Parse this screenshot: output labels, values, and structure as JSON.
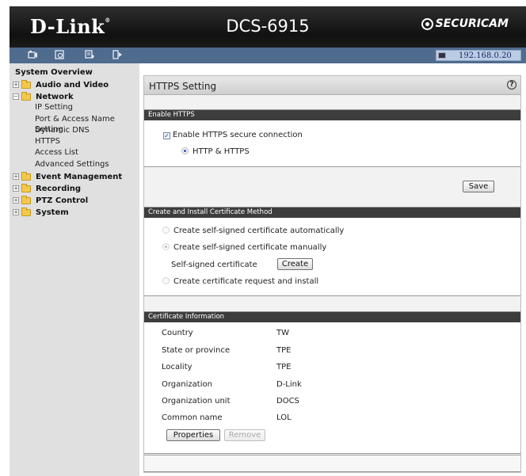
{
  "header": {
    "brand_logo": "D-Link",
    "registered_mark": "®",
    "model": "DCS-6915",
    "product_line": "SECURICAM"
  },
  "toolbar": {
    "icons": [
      "live-video-icon",
      "playback-icon",
      "setup-icon",
      "logout-icon"
    ],
    "ip_address": "192.168.0.20"
  },
  "sidebar": {
    "title": "System Overview",
    "groups": [
      {
        "label": "Audio and Video",
        "expanded": false
      },
      {
        "label": "Network",
        "expanded": true,
        "items": [
          "IP Setting",
          "Port & Access Name Setting",
          "Dynamic DNS",
          "HTTPS",
          "Access List",
          "Advanced Settings"
        ]
      },
      {
        "label": "Event Management",
        "expanded": false
      },
      {
        "label": "Recording",
        "expanded": false
      },
      {
        "label": "PTZ Control",
        "expanded": false
      },
      {
        "label": "System",
        "expanded": false
      }
    ]
  },
  "page": {
    "title": "HTTPS Setting",
    "help_glyph": "?"
  },
  "enable_section": {
    "header": "Enable HTTPS",
    "checkbox_label": "Enable HTTPS secure connection",
    "checkbox_checked": true,
    "mode_label": "HTTP & HTTPS",
    "save_label": "Save"
  },
  "cert_method": {
    "header": "Create and Install Certificate Method",
    "option_auto": "Create self-signed certificate automatically",
    "option_manual": "Create self-signed certificate manually",
    "self_signed_label": "Self-signed certificate",
    "create_label": "Create",
    "option_request": "Create certificate request and install",
    "selected": "manual"
  },
  "cert_info": {
    "header": "Certificate Information",
    "rows": [
      {
        "label": "Country",
        "value": "TW"
      },
      {
        "label": "State or province",
        "value": "TPE"
      },
      {
        "label": "Locality",
        "value": "TPE"
      },
      {
        "label": "Organization",
        "value": "D-Link"
      },
      {
        "label": "Organization unit",
        "value": "DOCS"
      },
      {
        "label": "Common name",
        "value": "LOL"
      }
    ],
    "properties_label": "Properties",
    "remove_label": "Remove"
  }
}
